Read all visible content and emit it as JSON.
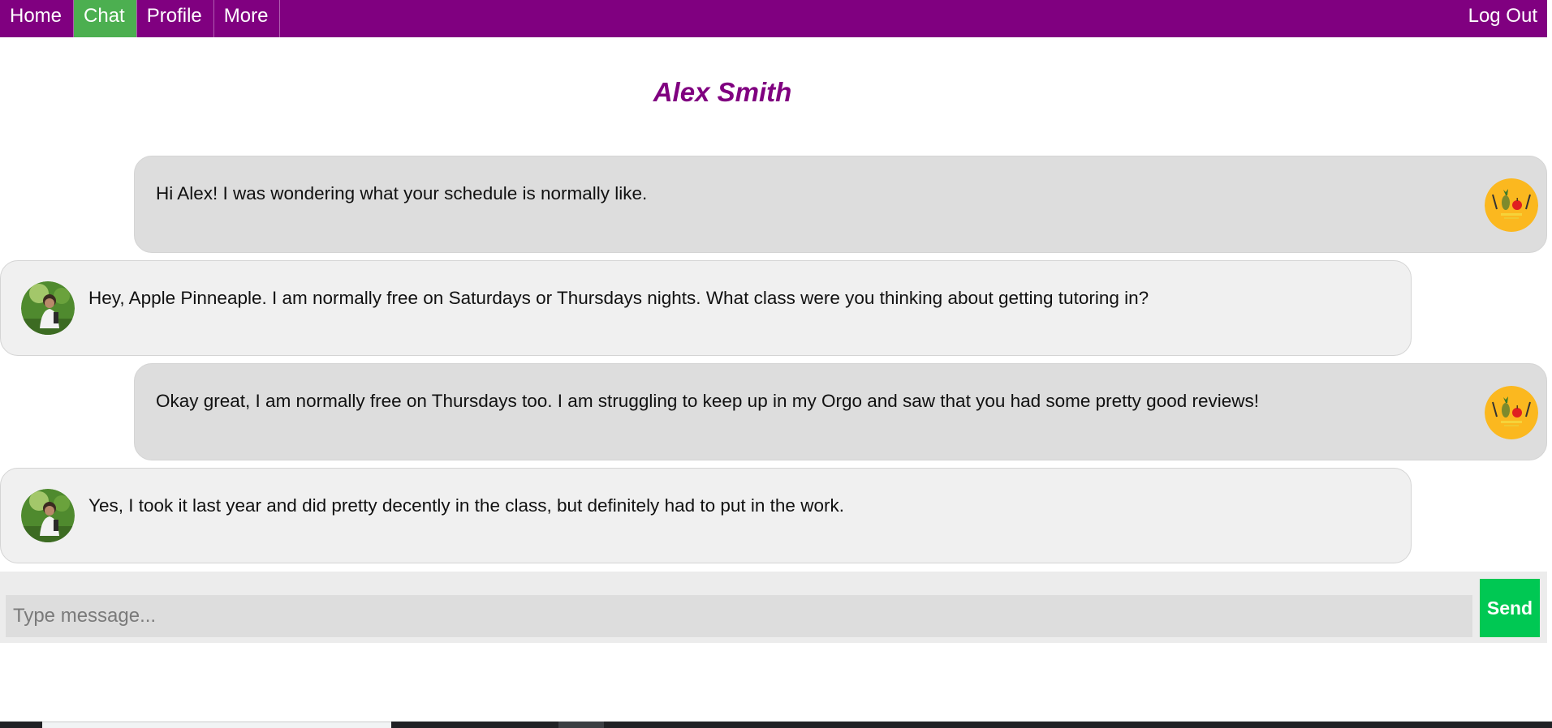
{
  "nav": {
    "items": [
      {
        "label": "Home",
        "active": false
      },
      {
        "label": "Chat",
        "active": true
      },
      {
        "label": "Profile",
        "active": false
      },
      {
        "label": "More",
        "active": false
      }
    ],
    "logout_label": "Log Out"
  },
  "title": "Alex Smith",
  "messages": [
    {
      "side": "sent",
      "avatar": "pineapple-apple-logo-avatar",
      "text": "Hi Alex! I was wondering what your schedule is normally like."
    },
    {
      "side": "received",
      "avatar": "alex-smith-photo-avatar",
      "text": "Hey, Apple Pinneaple. I am normally free on Saturdays or Thursdays nights. What class were you thinking about getting tutoring in?"
    },
    {
      "side": "sent",
      "avatar": "pineapple-apple-logo-avatar",
      "text": "Okay great, I am normally free on Thursdays too. I am struggling to keep up in my Orgo and saw that you had some pretty good reviews!"
    },
    {
      "side": "received",
      "avatar": "alex-smith-photo-avatar",
      "text": "Yes, I took it last year and did pretty decently in the class, but definitely had to put in the work."
    }
  ],
  "composer": {
    "placeholder": "Type message...",
    "value": "",
    "send_label": "Send"
  },
  "colors": {
    "nav_bg": "#800080",
    "nav_active": "#4caf50",
    "title": "#800080",
    "send_button": "#00c853",
    "sent_bubble": "#dddddd",
    "received_bubble": "#f0f0f0"
  }
}
